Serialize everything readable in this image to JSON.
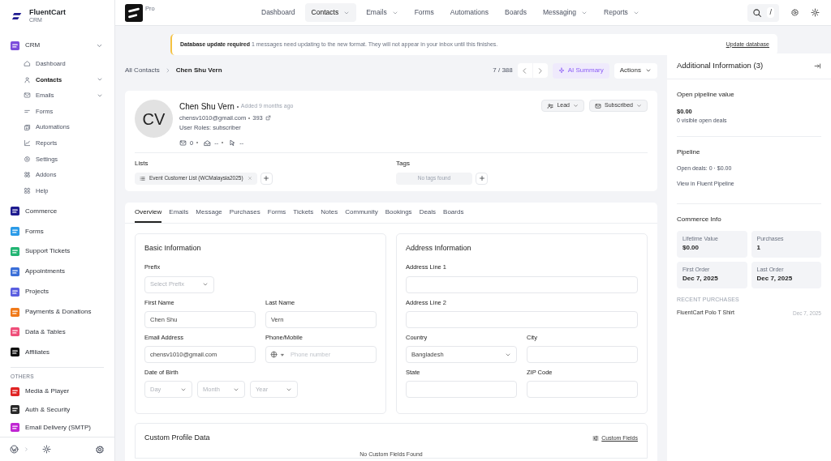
{
  "brand": {
    "name": "FluentCart",
    "subtitle": "CRM"
  },
  "sidebar": {
    "apps": [
      {
        "label": "CRM",
        "color": "#7c4ddb",
        "expanded": true,
        "children": [
          {
            "label": "Dashboard",
            "selected": false,
            "has_menu": false
          },
          {
            "label": "Contacts",
            "selected": true,
            "has_menu": true
          },
          {
            "label": "Emails",
            "selected": false,
            "has_menu": true
          },
          {
            "label": "Forms",
            "selected": false,
            "has_menu": false
          },
          {
            "label": "Automations",
            "selected": false,
            "has_menu": false
          },
          {
            "label": "Reports",
            "selected": false,
            "has_menu": false
          },
          {
            "label": "Settings",
            "selected": false,
            "has_menu": false
          },
          {
            "label": "Addons",
            "selected": false,
            "has_menu": false
          },
          {
            "label": "Help",
            "selected": false,
            "has_menu": false
          }
        ]
      },
      {
        "label": "Commerce",
        "color": "#1e1b8f"
      },
      {
        "label": "Forms",
        "color": "#2b9be8"
      },
      {
        "label": "Support Tickets",
        "color": "#22b573"
      },
      {
        "label": "Appointments",
        "color": "#3b6fd8"
      },
      {
        "label": "Projects",
        "color": "#5a5ee0"
      },
      {
        "label": "Payments & Donations",
        "color": "#f07a1a"
      },
      {
        "label": "Data & Tables",
        "color": "#ef4f7a"
      },
      {
        "label": "Affiliates",
        "color": "#111111"
      }
    ],
    "others_heading": "OTHERS",
    "others": [
      {
        "label": "Media & Player",
        "color": "#e02424"
      },
      {
        "label": "Auth & Security",
        "color": "#2a2a2a"
      },
      {
        "label": "Email Delivery (SMTP)",
        "color": "#c026d3"
      }
    ]
  },
  "topnav": {
    "badge": "Pro",
    "items": [
      {
        "label": "Dashboard",
        "selected": false,
        "has_menu": false
      },
      {
        "label": "Contacts",
        "selected": true,
        "has_menu": true
      },
      {
        "label": "Emails",
        "selected": false,
        "has_menu": true
      },
      {
        "label": "Forms",
        "selected": false,
        "has_menu": false
      },
      {
        "label": "Automations",
        "selected": false,
        "has_menu": false
      },
      {
        "label": "Boards",
        "selected": false,
        "has_menu": false
      },
      {
        "label": "Messaging",
        "selected": false,
        "has_menu": true
      },
      {
        "label": "Reports",
        "selected": false,
        "has_menu": true
      }
    ],
    "search_key": "/"
  },
  "notice": {
    "title": "Database update required",
    "message": "1 messages need updating to the new format. They will not appear in your inbox until this finishes.",
    "action": "Update database"
  },
  "breadcrumb": [
    "All Contacts",
    "Chen Shu Vern"
  ],
  "pager": "7 / 388",
  "ai_button": "AI Summary",
  "actions_button": "Actions",
  "contact": {
    "initials": "CV",
    "name": "Chen Shu Vern",
    "added": "Added 9 months ago",
    "email": "chensv1010@gmail.com",
    "id": "393",
    "roles": "User Roles: subscriber",
    "stats": [
      "0",
      "--",
      "--"
    ],
    "status_buttons": [
      "Lead",
      "Subscribed"
    ]
  },
  "lists": {
    "label": "Lists",
    "items": [
      "Event Customer List (WCMalaysia2025)"
    ]
  },
  "tags": {
    "label": "Tags",
    "empty": "No tags found"
  },
  "tabs": [
    {
      "label": "Overview",
      "selected": true
    },
    {
      "label": "Emails",
      "selected": false
    },
    {
      "label": "Message",
      "selected": false
    },
    {
      "label": "Purchases",
      "selected": false
    },
    {
      "label": "Forms",
      "selected": false
    },
    {
      "label": "Tickets",
      "selected": false
    },
    {
      "label": "Notes",
      "selected": false
    },
    {
      "label": "Community",
      "selected": false
    },
    {
      "label": "Bookings",
      "selected": false
    },
    {
      "label": "Deals",
      "selected": false
    },
    {
      "label": "Boards",
      "selected": false
    }
  ],
  "basic_info": {
    "title": "Basic Information",
    "rows": [
      [
        {
          "label": "Prefix",
          "kind": "select",
          "placeholder": "Select Prefix"
        }
      ],
      [
        {
          "label": "First Name",
          "kind": "text",
          "value": "Chen Shu"
        },
        {
          "label": "Last Name",
          "kind": "text",
          "value": "Vern"
        }
      ],
      [
        {
          "label": "Email Address",
          "kind": "text",
          "value": "chensv1010@gmail.com"
        },
        {
          "label": "Phone/Mobile",
          "kind": "phone",
          "placeholder": "Phone number"
        }
      ],
      [
        {
          "label": "Date of Birth",
          "kind": "date",
          "parts": [
            "Day",
            "Month",
            "Year"
          ]
        }
      ]
    ]
  },
  "address_info": {
    "title": "Address Information",
    "rows": [
      [
        {
          "label": "Address Line 1",
          "kind": "text"
        }
      ],
      [
        {
          "label": "Address Line 2",
          "kind": "text"
        }
      ],
      [
        {
          "label": "Country",
          "kind": "select",
          "value": "Bangladesh"
        },
        {
          "label": "City",
          "kind": "text"
        }
      ],
      [
        {
          "label": "State",
          "kind": "text"
        },
        {
          "label": "ZIP Code",
          "kind": "text"
        }
      ]
    ]
  },
  "custom_profile": {
    "title": "Custom Profile Data",
    "link": "Custom Fields",
    "empty": "No Custom Fields Found"
  },
  "panel": {
    "title": "Additional Information (3)",
    "pipeline_value": {
      "title": "Open pipeline value",
      "amount": "$0.00",
      "note": "0 visible open deals"
    },
    "pipeline": {
      "title": "Pipeline",
      "deals": "Open deals: 0 · $0.00",
      "link": "View in Fluent Pipeline"
    },
    "commerce": {
      "title": "Commerce Info",
      "stats": [
        {
          "label": "Lifetime Value",
          "value": "$0.00"
        },
        {
          "label": "Purchases",
          "value": "1"
        },
        {
          "label": "First Order",
          "value": "Dec 7, 2025"
        },
        {
          "label": "Last Order",
          "value": "Dec 7, 2025"
        }
      ],
      "recent_heading": "RECENT PURCHASES",
      "recent": [
        {
          "product": "FluentCart Polo T Shirt",
          "date": "Dec 7, 2025"
        }
      ]
    }
  }
}
